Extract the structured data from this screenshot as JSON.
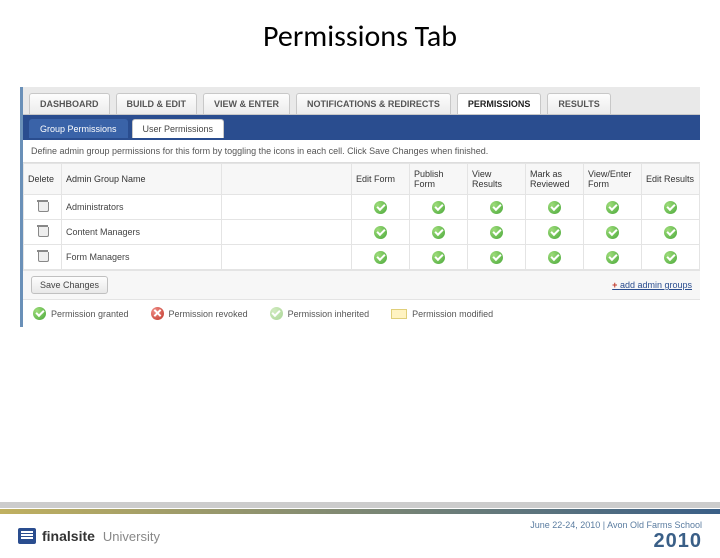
{
  "slide_title": "Permissions Tab",
  "main_tabs": [
    {
      "label": "DASHBOARD"
    },
    {
      "label": "BUILD & EDIT"
    },
    {
      "label": "VIEW & ENTER"
    },
    {
      "label": "NOTIFICATIONS & REDIRECTS"
    },
    {
      "label": "PERMISSIONS",
      "active": true
    },
    {
      "label": "RESULTS"
    }
  ],
  "sub_tabs": [
    {
      "label": "Group Permissions",
      "active": true
    },
    {
      "label": "User Permissions"
    }
  ],
  "help_text": "Define admin group permissions for this form by toggling the icons in each cell. Click Save Changes when finished.",
  "columns": {
    "delete": "Delete",
    "name": "Admin Group Name",
    "edit": "Edit Form",
    "publish": "Publish Form",
    "view": "View Results",
    "mark": "Mark as Reviewed",
    "viewenter": "View/Enter Form",
    "editres": "Edit Results"
  },
  "groups": [
    {
      "name": "Administrators"
    },
    {
      "name": "Content Managers"
    },
    {
      "name": "Form Managers"
    }
  ],
  "save_label": "Save Changes",
  "add_link_label": "add admin groups",
  "legend": {
    "granted": "Permission granted",
    "revoked": "Permission revoked",
    "inherited": "Permission inherited",
    "modified": "Permission modified"
  },
  "footer": {
    "brand1": "finalsite",
    "brand2": "University",
    "event_line": "June 22-24, 2010 | Avon Old Farms School",
    "event_year": "2010"
  }
}
